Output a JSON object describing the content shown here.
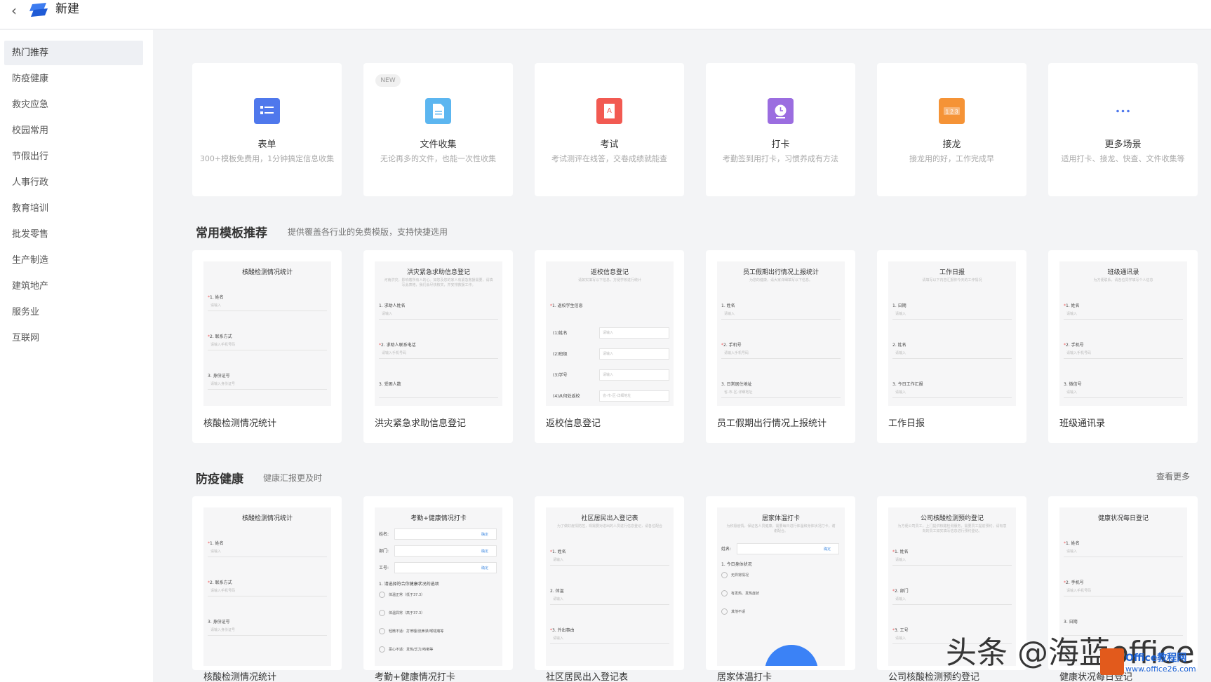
{
  "header": {
    "title": "新建",
    "back_icon": "chevron-left-icon",
    "logo_icon": "logo-icon"
  },
  "sidebar": {
    "items": [
      {
        "label": "热门推荐",
        "active": true
      },
      {
        "label": "防疫健康"
      },
      {
        "label": "救灾应急"
      },
      {
        "label": "校园常用"
      },
      {
        "label": "节假出行"
      },
      {
        "label": "人事行政"
      },
      {
        "label": "教育培训"
      },
      {
        "label": "批发零售"
      },
      {
        "label": "生产制造"
      },
      {
        "label": "建筑地产"
      },
      {
        "label": "服务业"
      },
      {
        "label": "互联网"
      }
    ]
  },
  "scenes": [
    {
      "title": "表单",
      "desc": "300+模板免费用，1分钟搞定信息收集",
      "icon": "form-icon",
      "color": "#4f78ec"
    },
    {
      "title": "文件收集",
      "desc": "无论再多的文件，也能一次性收集",
      "icon": "document-icon",
      "color": "#5cb6f0",
      "badge": "NEW"
    },
    {
      "title": "考试",
      "desc": "考试测评在线答，交卷成绩就能查",
      "icon": "exam-icon",
      "color": "#f25a52"
    },
    {
      "title": "打卡",
      "desc": "考勤签到用打卡，习惯养成有方法",
      "icon": "clock-icon",
      "color": "#9b6de0"
    },
    {
      "title": "接龙",
      "desc": "接龙用的好，工作完成早",
      "icon": "relay-icon",
      "color": "#f59336"
    },
    {
      "title": "更多场景",
      "desc": "适用打卡、接龙、快查、文件收集等",
      "icon": "more-icon",
      "color": "#4f78ec"
    }
  ],
  "section_common": {
    "title": "常用模板推荐",
    "subtitle": "提供覆盖各行业的免费模版，支持快捷选用"
  },
  "section_health": {
    "title": "防疫健康",
    "subtitle": "健康汇报更及时",
    "more": "查看更多"
  },
  "templates_common": [
    {
      "name": "核酸检测情况统计",
      "preview_title": "核酸检测情况统计",
      "fields": [
        {
          "label": "1. 姓名",
          "req": true,
          "ph": "请输入"
        },
        {
          "label": "2. 联系方式",
          "req": true,
          "ph": "请输入手机号码"
        },
        {
          "label": "3. 身份证号",
          "ph": "请输入身份证号"
        }
      ]
    },
    {
      "name": "洪灾紧急求助信息登记",
      "preview_title": "洪灾紧急求助信息登记",
      "preview_desc": "河南洪灾，影响着所有人的心。如您及您的家人有紧急救援需要，请填写此表格，我们会尽快核实，并安排救援工作。",
      "fields": [
        {
          "label": "1. 求助人姓名",
          "ph": "请输入"
        },
        {
          "label": "2. 求助人联系电话",
          "req": true,
          "ph": "请输入手机号码"
        },
        {
          "label": "3. 受困人数",
          "ph": ""
        }
      ]
    },
    {
      "name": "返校信息登记",
      "preview_title": "返校信息登记",
      "preview_desc": "请如实填写以下信息，方便学校进行统计",
      "fields": [
        {
          "label": "1. 返校学生信息",
          "req": true
        }
      ],
      "subs": [
        {
          "label": "(1)姓名",
          "ph": "请输入"
        },
        {
          "label": "(2)班级",
          "ph": "请输入"
        },
        {
          "label": "(3)学号",
          "ph": "请输入"
        },
        {
          "label": "(4)从何处返校",
          "ph": "省-市-区-详细地址"
        }
      ]
    },
    {
      "name": "员工假期出行情况上报统计",
      "preview_title": "员工假期出行情况上报统计",
      "preview_desc": "为您的健康，请大家详细填写以下信息。",
      "fields": [
        {
          "label": "1. 姓名",
          "ph": "请输入"
        },
        {
          "label": "2. 手机号",
          "req": true,
          "ph": "请输入手机号码"
        },
        {
          "label": "3. 日常居住地址",
          "ph": "省-市-区-详细地址"
        }
      ]
    },
    {
      "name": "工作日报",
      "preview_title": "工作日报",
      "preview_desc": "请填写以下内容汇报你今天的工作情况",
      "fields": [
        {
          "label": "1. 日期",
          "ph": "请输入"
        },
        {
          "label": "2. 姓名",
          "ph": "请输入"
        },
        {
          "label": "3. 今日工作汇报",
          "ph": "请输入"
        }
      ]
    },
    {
      "name": "班级通讯录",
      "preview_title": "班级通讯录",
      "preview_desc": "为方便联系，请各位同学填写个人信息",
      "fields": [
        {
          "label": "1. 姓名",
          "req": true,
          "ph": "请输入"
        },
        {
          "label": "2. 手机号",
          "req": true,
          "ph": "请输入手机号码"
        },
        {
          "label": "3. 微信号",
          "ph": "请输入"
        }
      ]
    }
  ],
  "templates_health": [
    {
      "name": "核酸检测情况统计",
      "preview_title": "核酸检测情况统计",
      "fields": [
        {
          "label": "1. 姓名",
          "req": true,
          "ph": "请输入"
        },
        {
          "label": "2. 联系方式",
          "req": true,
          "ph": "请输入手机号码"
        },
        {
          "label": "3. 身份证号",
          "ph": "请输入身份证号"
        }
      ]
    },
    {
      "name": "考勤+健康情况打卡",
      "preview_title": "考勤+健康情况打卡",
      "boxes": [
        {
          "label": "姓名:",
          "btn": "确定"
        },
        {
          "label": "部门:",
          "btn": "确定"
        },
        {
          "label": "工号:",
          "btn": "确定"
        }
      ],
      "question": "1. 请选择符合你健康状况的选项",
      "options": [
        "体温正常（低于37.3）",
        "体温异常（高于37.3）",
        "轻微不适：打喷嚏/流鼻涕/喉咙痛等",
        "恶心不适：发热/乏力/咳嗽等"
      ]
    },
    {
      "name": "社区居民出入登记表",
      "preview_title": "社区居民出入登记表",
      "preview_desc": "为了做好疫情防控，现需要对进出的人员进行信息登记，请各位配合",
      "fields": [
        {
          "label": "1. 姓名",
          "req": true,
          "ph": "请输入"
        },
        {
          "label": "2. 体温",
          "ph": "请输入"
        },
        {
          "label": "3. 外出事由",
          "req": true,
          "ph": "请输入"
        }
      ]
    },
    {
      "name": "居家体温打卡",
      "preview_title": "居家体温打卡",
      "preview_desc": "为积极疫情，保证各人员健康，需要每日进行体温和身体状况打卡，谢谢配合。",
      "box": {
        "label": "姓名:",
        "btn": "确定"
      },
      "question": "1. 今日身体状况",
      "options": [
        "无异常情况",
        "有发热、发热症状",
        "其他不适"
      ]
    },
    {
      "name": "公司核酸检测预约登记",
      "preview_title": "公司核酸检测预约登记",
      "preview_desc": "为方便公司员工，上门提供核酸检测服务，需要员工提前预约，请有意向的员工如实填写信息进行预约登记。",
      "fields": [
        {
          "label": "1. 姓名",
          "req": true,
          "ph": "请输入"
        },
        {
          "label": "2. 部门",
          "req": true,
          "ph": "请输入"
        },
        {
          "label": "3. 工号",
          "req": true,
          "ph": "请输入"
        }
      ]
    },
    {
      "name": "健康状况每日登记",
      "preview_title": "健康状况每日登记",
      "fields": [
        {
          "label": "1. 姓名",
          "req": true,
          "ph": "请输入"
        },
        {
          "label": "2. 手机号",
          "req": true,
          "ph": "请输入手机号码"
        },
        {
          "label": "3. 日期",
          "ph": ""
        }
      ]
    }
  ],
  "watermark": {
    "text": "头条 @海蓝office",
    "logo_line1": "Office教程网",
    "logo_line2": "www.office26.com"
  }
}
